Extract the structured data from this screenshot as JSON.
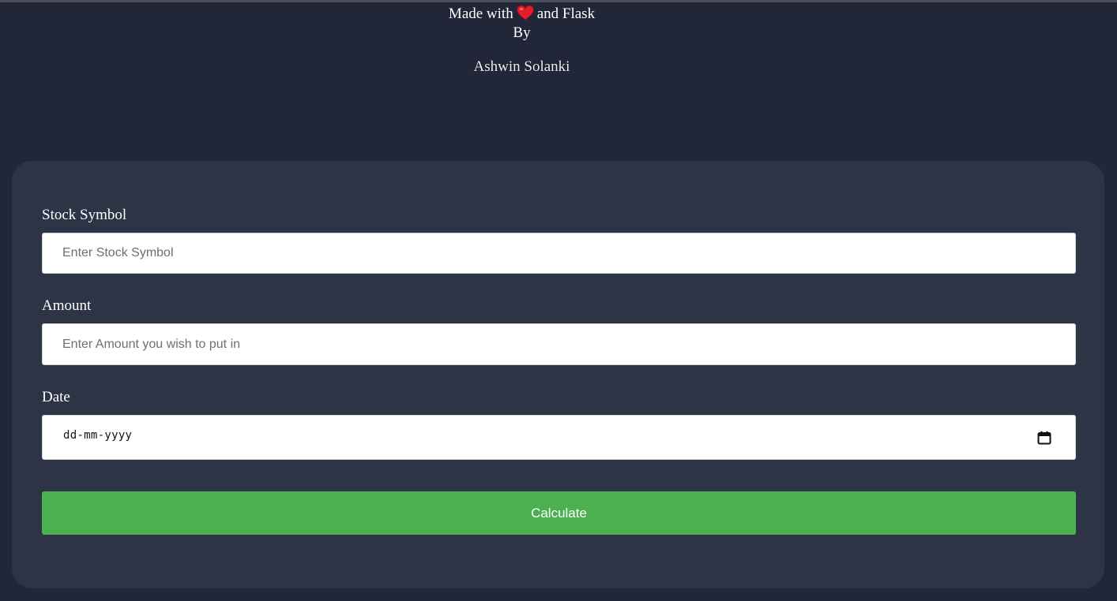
{
  "header": {
    "made_with_prefix": "Made with",
    "made_with_suffix": "and Flask",
    "heart_icon": "heart-icon",
    "by": "By",
    "author": "Ashwin Solanki"
  },
  "form": {
    "stock_symbol": {
      "label": "Stock Symbol",
      "placeholder": "Enter Stock Symbol",
      "value": ""
    },
    "amount": {
      "label": "Amount",
      "placeholder": "Enter Amount you wish to put in",
      "value": ""
    },
    "date": {
      "label": "Date",
      "placeholder": "dd-mm-yyyy",
      "icon": "calendar-icon"
    },
    "submit_label": "Calculate"
  },
  "colors": {
    "page_background": "#212738",
    "card_background": "#2d3446",
    "button_green": "#4caf50",
    "heart_red": "#e0202c"
  }
}
